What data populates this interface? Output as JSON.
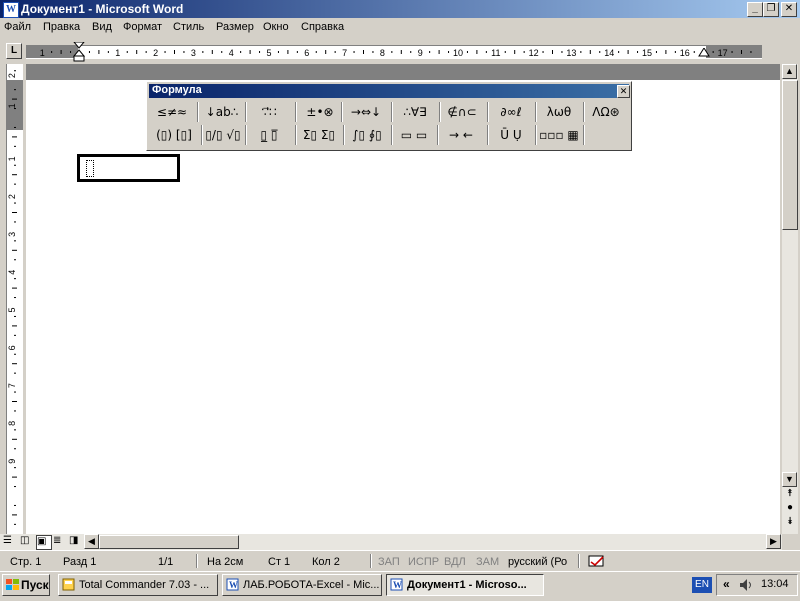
{
  "window": {
    "title": "Документ1 - Microsoft Word",
    "app_icon": "W"
  },
  "caption_buttons": {
    "minimize": "_",
    "restore": "❐",
    "close": "✕"
  },
  "menu": [
    "Файл",
    "Правка",
    "Вид",
    "Формат",
    "Стиль",
    "Размер",
    "Окно",
    "Справка"
  ],
  "ruler_corner": "L",
  "hruler_labels": [
    "1",
    "1",
    "2",
    "3",
    "4",
    "5",
    "6",
    "7",
    "8",
    "9",
    "10",
    "11",
    "12",
    "13",
    "14",
    "15",
    "16",
    "17"
  ],
  "vruler_labels": [
    "2",
    "1",
    "1",
    "2",
    "3",
    "4",
    "5",
    "6",
    "7",
    "8",
    "9"
  ],
  "formula_toolbar": {
    "title": "Формула",
    "close": "✕",
    "row1": [
      "≤≠≈",
      "↓ab∴",
      "∵⃗∷",
      "±•⊗",
      "→⇔↓",
      "∴∀∃",
      "∉∩⊂",
      "∂∞ℓ",
      "λωθ",
      "ΛΩ⊛"
    ],
    "row2": [
      "(▯) [▯]",
      "▯/▯ √▯",
      "▯̲ ▯̅",
      "Σ▯ Σ▯",
      "∫▯ ∮▯",
      "▭ ▭",
      "→ ←",
      "Ū Ụ",
      "▫▫▫ ▦"
    ]
  },
  "status": {
    "page": "Стр. 1",
    "section": "Разд 1",
    "pages": "1/1",
    "at": "На 2см",
    "line": "Ст 1",
    "col": "Кол 2",
    "rec": "ЗАП",
    "trk": "ИСПР",
    "ext": "ВДЛ",
    "ovr": "ЗАМ",
    "lang": "русский (Ро"
  },
  "taskbar": {
    "start": "Пуск",
    "tasks": [
      {
        "label": "Total Commander 7.03 - ...",
        "active": false
      },
      {
        "label": "ЛАБ.РОБОТА-Excel - Mic...",
        "active": false
      },
      {
        "label": "Документ1 - Microso...",
        "active": true
      }
    ],
    "lang": "EN",
    "clock": "13:04"
  }
}
